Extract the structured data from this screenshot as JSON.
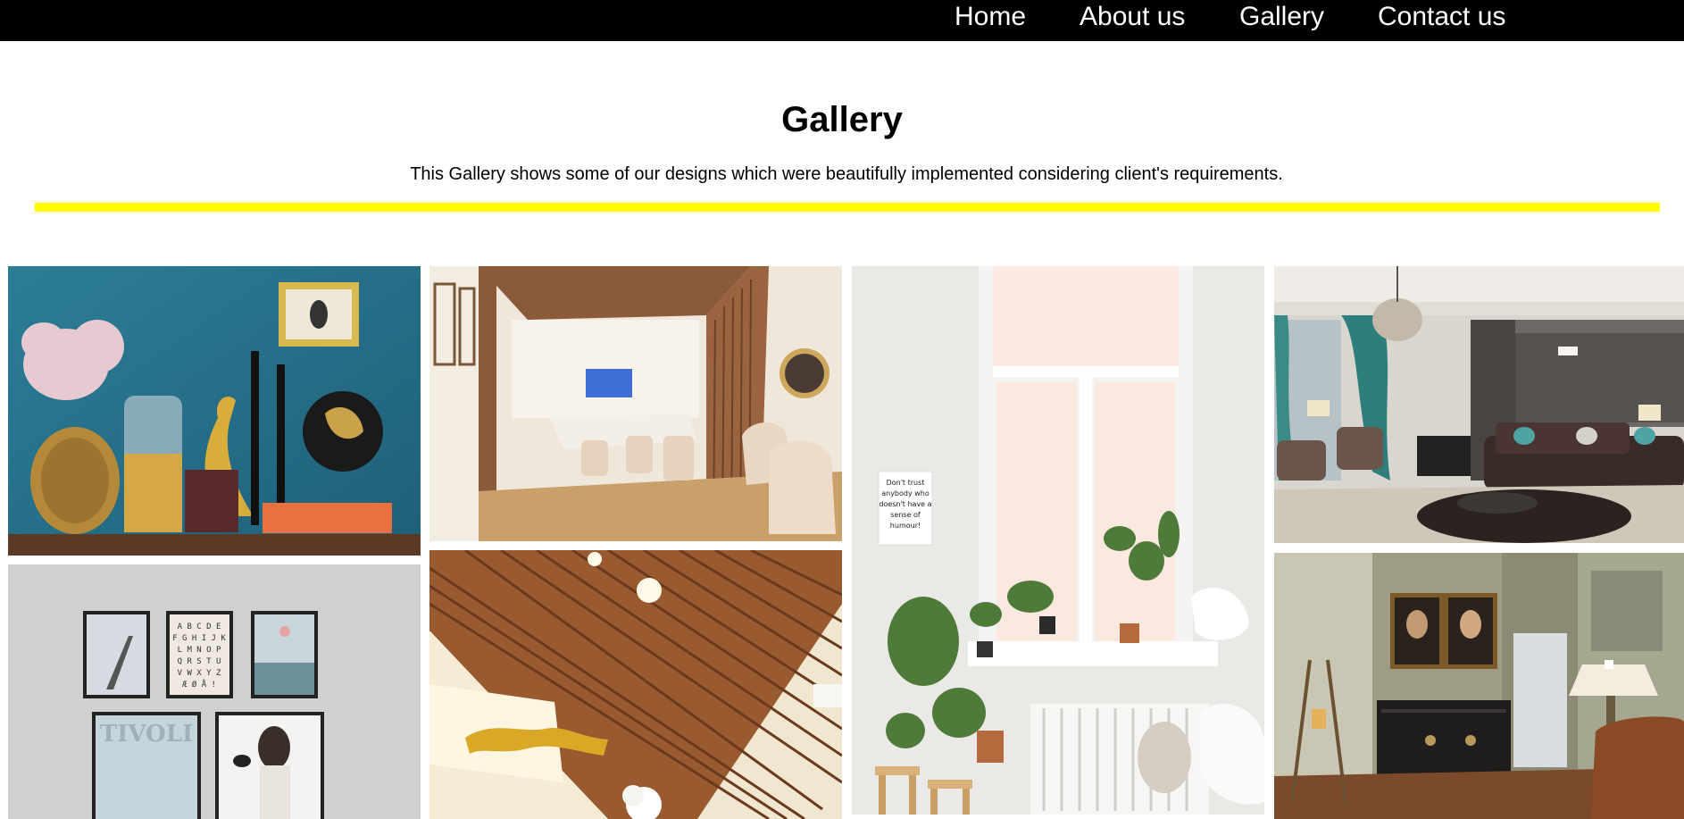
{
  "nav": {
    "items": [
      {
        "label": "Home"
      },
      {
        "label": "About us"
      },
      {
        "label": "Gallery"
      },
      {
        "label": "Contact us"
      }
    ]
  },
  "header": {
    "title": "Gallery",
    "description": "This Gallery shows some of our designs which were beautifully implemented considering client's requirements."
  },
  "colors": {
    "nav_bg": "#000000",
    "nav_text": "#ffffff",
    "divider": "#ffff00"
  },
  "gallery": {
    "images": [
      {
        "name": "decor-shelf-photo"
      },
      {
        "name": "meeting-room-photo"
      },
      {
        "name": "window-plants-photo"
      },
      {
        "name": "living-room-photo"
      },
      {
        "name": "framed-art-wall-photo"
      },
      {
        "name": "wood-slat-ceiling-photo"
      },
      {
        "name": "hallway-portraits-photo"
      }
    ],
    "texts": {
      "poster_words": "TIVOLI",
      "alphabet_rows": [
        "A B C D E",
        "F G H I J K",
        "L M N O P",
        "Q R S T U",
        "V W X Y Z",
        "Æ Ø Å !"
      ],
      "note_lines": [
        "Don't trust",
        "anybody who",
        "doesn't have a",
        "sense of",
        "humour!"
      ]
    }
  }
}
